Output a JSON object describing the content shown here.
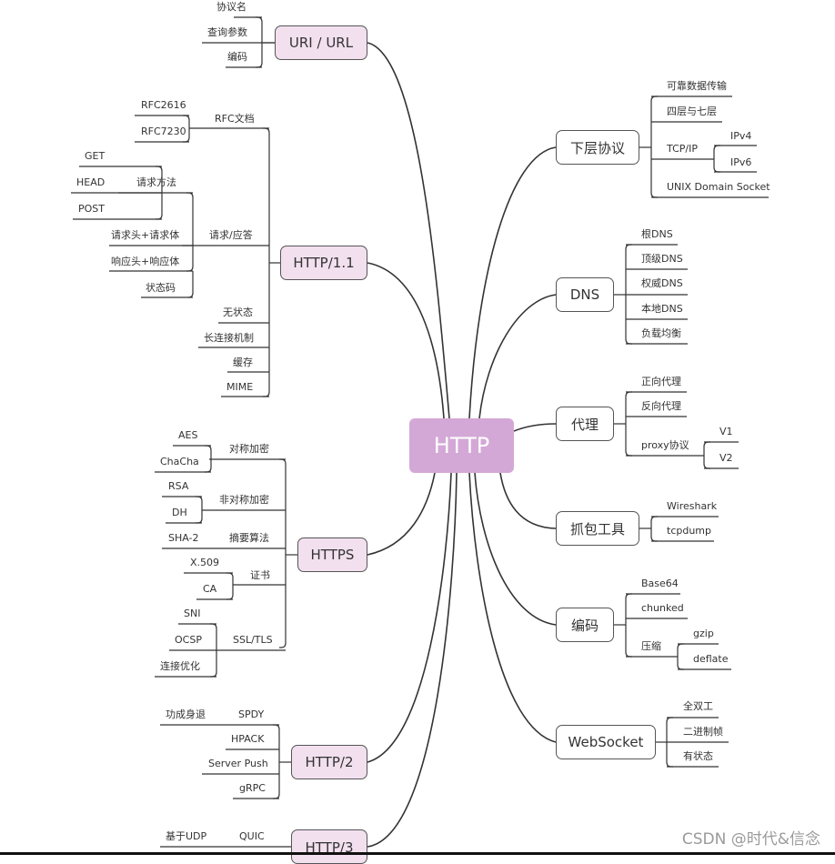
{
  "root": {
    "label": "HTTP",
    "color": "#d4a8d6"
  },
  "colors": {
    "left_node_fill": "#f2e0ef",
    "right_node_fill": "#ffffff",
    "line": "#333333"
  },
  "left_branches": [
    {
      "label": "URI /  URL",
      "children": [
        {
          "label": "协议名"
        },
        {
          "label": "查询参数"
        },
        {
          "label": "编码"
        }
      ]
    },
    {
      "label": "HTTP/1.1",
      "children": [
        {
          "label": "RFC文档",
          "children": [
            {
              "label": "RFC2616"
            },
            {
              "label": "RFC7230"
            }
          ]
        },
        {
          "label": "请求/应答",
          "children": [
            {
              "label": "请求方法",
              "children": [
                {
                  "label": "GET"
                },
                {
                  "label": "HEAD"
                },
                {
                  "label": "POST"
                }
              ]
            },
            {
              "label": "请求头+请求体"
            },
            {
              "label": "响应头+响应体"
            },
            {
              "label": "状态码"
            }
          ]
        },
        {
          "label": "无状态"
        },
        {
          "label": "长连接机制"
        },
        {
          "label": "缓存"
        },
        {
          "label": "MIME"
        }
      ]
    },
    {
      "label": "HTTPS",
      "children": [
        {
          "label": "对称加密",
          "children": [
            {
              "label": "AES"
            },
            {
              "label": "ChaCha"
            }
          ]
        },
        {
          "label": "非对称加密",
          "children": [
            {
              "label": "RSA"
            },
            {
              "label": "DH"
            }
          ]
        },
        {
          "label": "摘要算法",
          "children": [
            {
              "label": "SHA-2"
            }
          ]
        },
        {
          "label": "证书",
          "children": [
            {
              "label": "X.509"
            },
            {
              "label": "CA"
            }
          ]
        },
        {
          "label": "SSL/TLS",
          "children": [
            {
              "label": "SNI"
            },
            {
              "label": "OCSP"
            },
            {
              "label": "连接优化"
            }
          ]
        }
      ]
    },
    {
      "label": "HTTP/2",
      "children": [
        {
          "label": "SPDY",
          "children": [
            {
              "label": "功成身退"
            }
          ]
        },
        {
          "label": "HPACK"
        },
        {
          "label": "Server Push"
        },
        {
          "label": "gRPC"
        }
      ]
    },
    {
      "label": "HTTP/3",
      "children": [
        {
          "label": "QUIC",
          "children": [
            {
              "label": "基于UDP"
            }
          ]
        }
      ]
    }
  ],
  "right_branches": [
    {
      "label": "下层协议",
      "children": [
        {
          "label": "可靠数据传输"
        },
        {
          "label": "四层与七层"
        },
        {
          "label": "TCP/IP",
          "children": [
            {
              "label": "IPv4"
            },
            {
              "label": "IPv6"
            }
          ]
        },
        {
          "label": "UNIX Domain Socket"
        }
      ]
    },
    {
      "label": "DNS",
      "children": [
        {
          "label": "根DNS"
        },
        {
          "label": "顶级DNS"
        },
        {
          "label": "权威DNS"
        },
        {
          "label": "本地DNS"
        },
        {
          "label": "负载均衡"
        }
      ]
    },
    {
      "label": "代理",
      "children": [
        {
          "label": "正向代理"
        },
        {
          "label": "反向代理"
        },
        {
          "label": "proxy协议",
          "children": [
            {
              "label": "V1"
            },
            {
              "label": "V2"
            }
          ]
        }
      ]
    },
    {
      "label": "抓包工具",
      "children": [
        {
          "label": "Wireshark"
        },
        {
          "label": "tcpdump"
        }
      ]
    },
    {
      "label": "编码",
      "children": [
        {
          "label": "Base64"
        },
        {
          "label": "chunked"
        },
        {
          "label": "压缩",
          "children": [
            {
              "label": "gzip"
            },
            {
              "label": "deflate"
            }
          ]
        }
      ]
    },
    {
      "label": "WebSocket",
      "children": [
        {
          "label": "全双工"
        },
        {
          "label": "二进制帧"
        },
        {
          "label": "有状态"
        }
      ]
    }
  ],
  "watermark": "CSDN @时代&信念"
}
